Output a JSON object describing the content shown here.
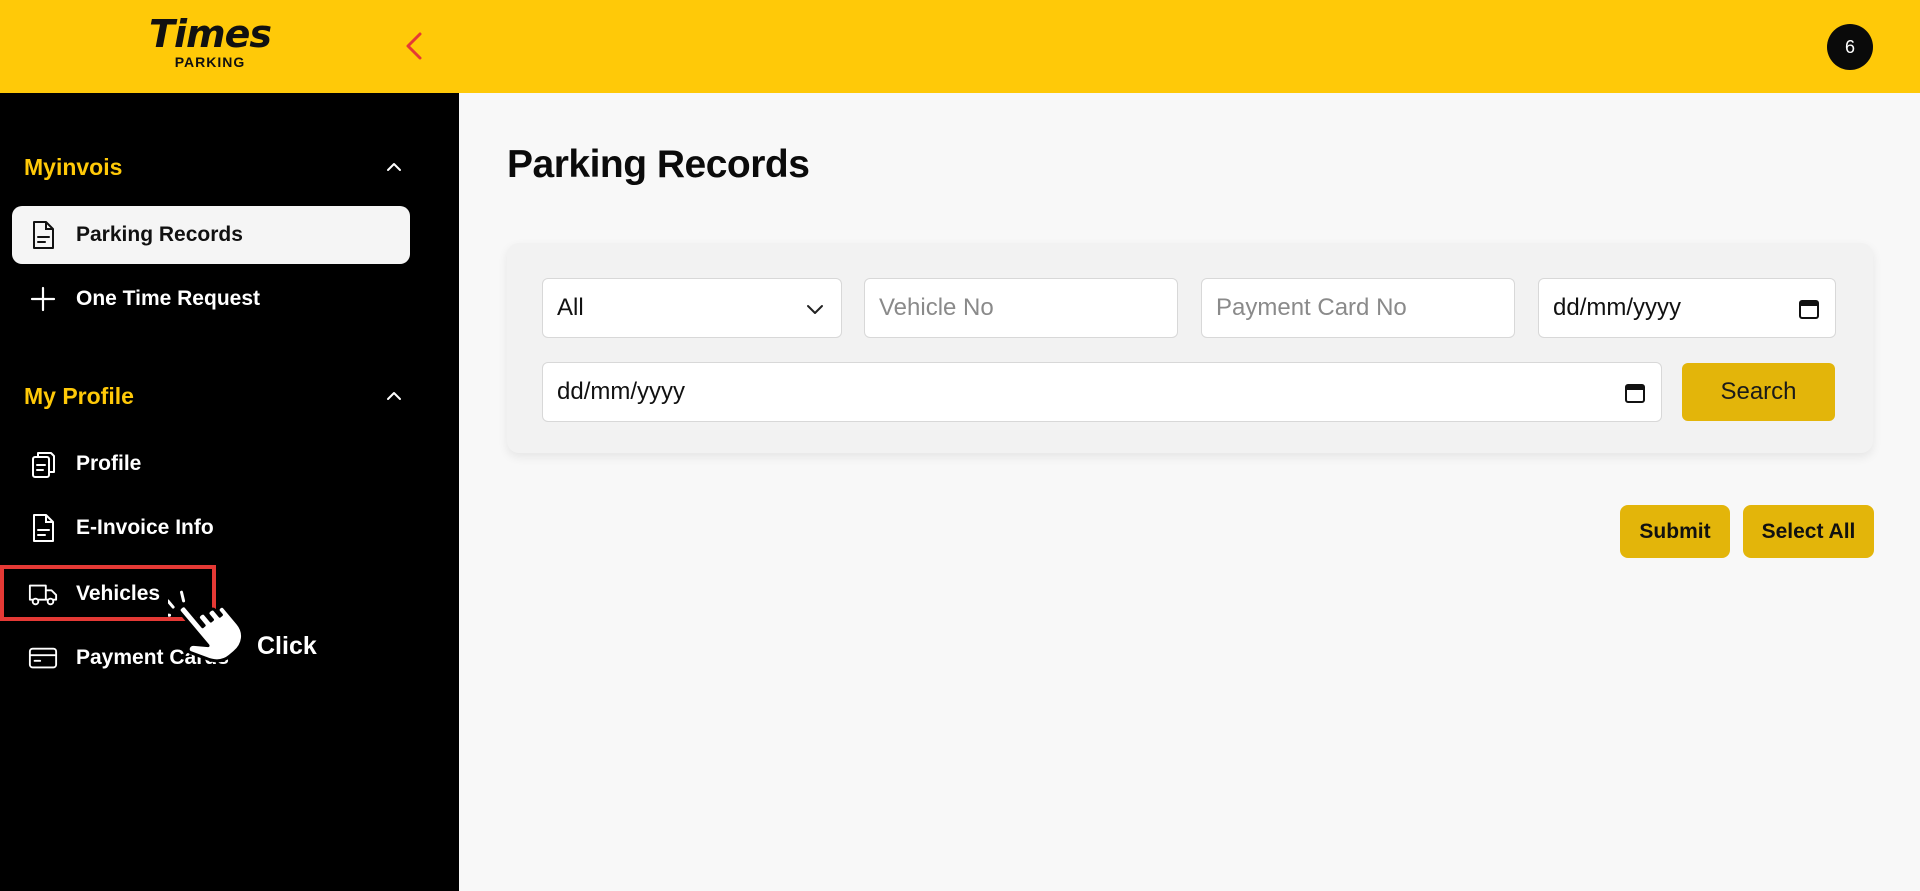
{
  "header": {
    "logo_main": "Times",
    "logo_sub": "PARKING",
    "notification_count": "6"
  },
  "sidebar": {
    "sections": [
      {
        "title": "Myinvois",
        "items": [
          {
            "label": "Parking Records",
            "icon": "document-icon",
            "active": true
          },
          {
            "label": "One Time Request",
            "icon": "plus-icon",
            "active": false
          }
        ]
      },
      {
        "title": "My Profile",
        "items": [
          {
            "label": "Profile",
            "icon": "clipboard-icon",
            "active": false
          },
          {
            "label": "E-Invoice Info",
            "icon": "document-icon",
            "active": false
          },
          {
            "label": "Vehicles",
            "icon": "truck-icon",
            "active": false
          },
          {
            "label": "Payment Cards",
            "icon": "credit-card-icon",
            "active": false
          }
        ]
      }
    ]
  },
  "annotation": {
    "click_label": "Click",
    "highlight_color": "#e53935"
  },
  "main": {
    "title": "Parking Records",
    "filters": {
      "type_select_value": "All",
      "vehicle_placeholder": "Vehicle No",
      "card_placeholder": "Payment Card No",
      "date_from": "dd/mm/yyyy",
      "date_to": "dd/mm/yyyy",
      "search_label": "Search"
    },
    "actions": {
      "submit_label": "Submit",
      "select_all_label": "Select All"
    }
  },
  "colors": {
    "brand_yellow": "#ffc908",
    "button_yellow": "#e3b50a",
    "sidebar_bg": "#000000"
  }
}
